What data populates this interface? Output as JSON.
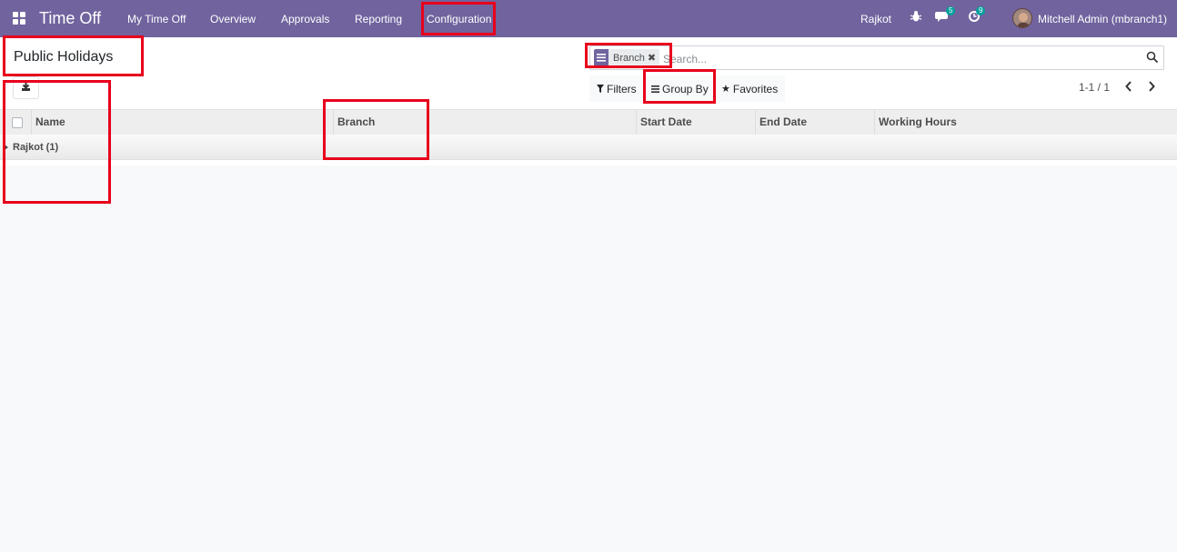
{
  "navbar": {
    "app_name": "Time Off",
    "menu": [
      "My Time Off",
      "Overview",
      "Approvals",
      "Reporting",
      "Configuration"
    ],
    "branch": "Rajkot",
    "messages_count": "5",
    "activities_count": "9",
    "user": "Mitchell Admin (mbranch1)"
  },
  "control_panel": {
    "title": "Public Holidays",
    "search": {
      "facet_label": "Branch",
      "placeholder": "Search..."
    },
    "filters_label": "Filters",
    "group_by_label": "Group By",
    "favorites_label": "Favorites",
    "pager": "1-1 / 1"
  },
  "list": {
    "columns": [
      "Name",
      "Branch",
      "Start Date",
      "End Date",
      "Working Hours"
    ],
    "groups": [
      {
        "label": "Rajkot (1)"
      }
    ]
  },
  "colors": {
    "brand": "#71639e",
    "highlight": "#e8001c",
    "badge": "#00a09d"
  }
}
